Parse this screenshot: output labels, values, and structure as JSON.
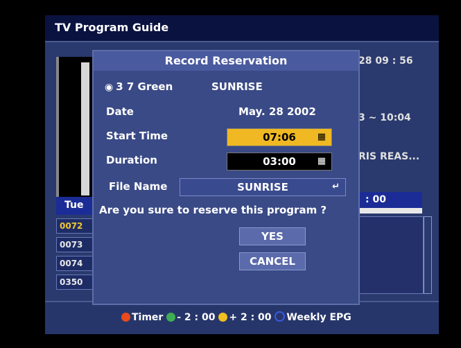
{
  "app": {
    "title": "TV Program Guide"
  },
  "background": {
    "date_tab": "Tue",
    "channels": [
      "0072",
      "0073",
      "0074",
      "0350"
    ],
    "right_clock": "28 09 : 56",
    "right_time_range": "3 ~ 10:04",
    "right_program": "RIS REAS...",
    "right_tab": ": 00"
  },
  "dialog": {
    "title": "Record Reservation",
    "channel": "3 7 Green",
    "program": "SUNRISE",
    "date_label": "Date",
    "date_value": "May. 28  2002",
    "start_label": "Start Time",
    "start_value": "07:06",
    "duration_label": "Duration",
    "duration_value": "03:00",
    "filename_label": "File Name",
    "filename_value": "SUNRISE",
    "question": "Are you sure to reserve this program ?",
    "yes": "YES",
    "cancel": "CANCEL"
  },
  "legend": {
    "timer": "Timer",
    "minus": "- 2 : 00",
    "plus": "+ 2 : 00",
    "weekly": "Weekly EPG"
  },
  "icons": {
    "tv": "tv-icon",
    "grid": "keypad-icon",
    "enter": "enter-icon"
  },
  "colors": {
    "highlight": "#f0b822",
    "timer_dot": "#e84a1e",
    "minus_dot": "#3fae52",
    "plus_dot": "#f0c020",
    "weekly_dot": "#3a5ae8"
  }
}
